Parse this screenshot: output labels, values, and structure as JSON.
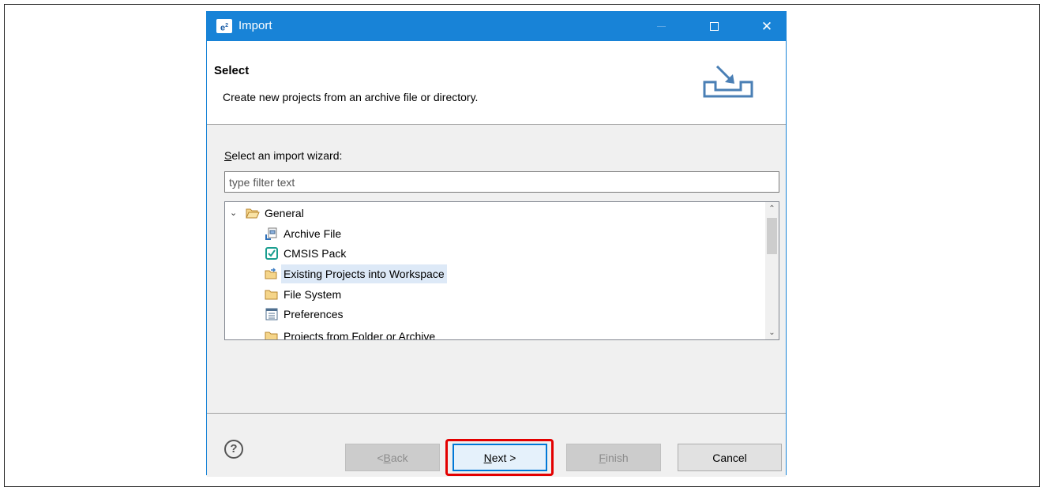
{
  "window": {
    "title": "Import",
    "app_icon_text": "e",
    "app_icon_sup": "2"
  },
  "header": {
    "title": "Select",
    "description": "Create new projects from an archive file or directory."
  },
  "wizard": {
    "label_prefix": "S",
    "label_rest": "elect an import wizard:",
    "filter_placeholder": "type filter text",
    "tree": {
      "root": {
        "label": "General",
        "icon": "open-folder-icon",
        "expanded": true
      },
      "items": [
        {
          "label": "Archive File",
          "icon": "archive-file-icon"
        },
        {
          "label": "CMSIS Pack",
          "icon": "cmsis-pack-icon"
        },
        {
          "label": "Existing Projects into Workspace",
          "icon": "existing-projects-icon",
          "selected": true
        },
        {
          "label": "File System",
          "icon": "folder-icon"
        },
        {
          "label": "Preferences",
          "icon": "preferences-icon"
        },
        {
          "label": "Projects from Folder or Archive",
          "icon": "folder-icon"
        }
      ]
    }
  },
  "buttons": {
    "back_pre": "< ",
    "back_u": "B",
    "back_rest": "ack",
    "next_u": "N",
    "next_rest": "ext >",
    "finish_u": "F",
    "finish_rest": "inish",
    "cancel": "Cancel"
  },
  "help_glyph": "?",
  "colors": {
    "titlebar": "#1883d7",
    "highlight": "#e30000",
    "selection": "#dde9f7"
  }
}
